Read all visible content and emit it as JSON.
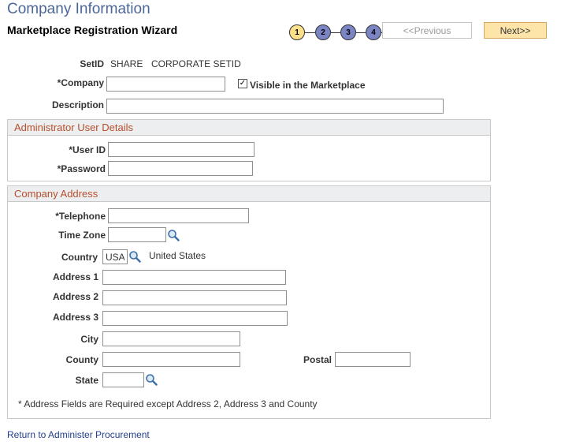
{
  "page": {
    "title": "Company Information",
    "wizard_title": "Marketplace Registration Wizard"
  },
  "wizard": {
    "steps": [
      "1",
      "2",
      "3",
      "4"
    ],
    "current_step": 1,
    "prev_label": "<<Previous",
    "next_label": "Next>>"
  },
  "form": {
    "setid_label": "SetID",
    "setid_value": "SHARE",
    "setid_description": "CORPORATE SETID",
    "company_label": "*Company",
    "company_value": "",
    "visible_label": "Visible in the Marketplace",
    "visible_checked": true,
    "check_mark": "✓",
    "description_label": "Description",
    "description_value": ""
  },
  "admin": {
    "header": "Administrator User Details",
    "userid_label": "*User ID",
    "userid_value": "",
    "password_label": "*Password",
    "password_value": ""
  },
  "address": {
    "header": "Company Address",
    "telephone_label": "*Telephone",
    "telephone_value": "",
    "timezone_label": "Time Zone",
    "timezone_value": "",
    "country_label": "Country",
    "country_value": "USA",
    "country_description": "United States",
    "address1_label": "Address 1",
    "address2_label": "Address 2",
    "address3_label": "Address 3",
    "city_label": "City",
    "county_label": "County",
    "postal_label": "Postal",
    "state_label": "State",
    "note": "* Address Fields are Required except Address 2, Address 3 and County"
  },
  "footer": {
    "return_link": "Return to Administer Procurement"
  },
  "colors": {
    "title": "#4c6797",
    "group_header_text": "#b64f2c",
    "current_step": "#fde08a",
    "other_step": "#7b84c4",
    "next_button": "#fde4a8",
    "link": "#23408e"
  },
  "icons": {
    "lookup": "magnifier-icon"
  }
}
